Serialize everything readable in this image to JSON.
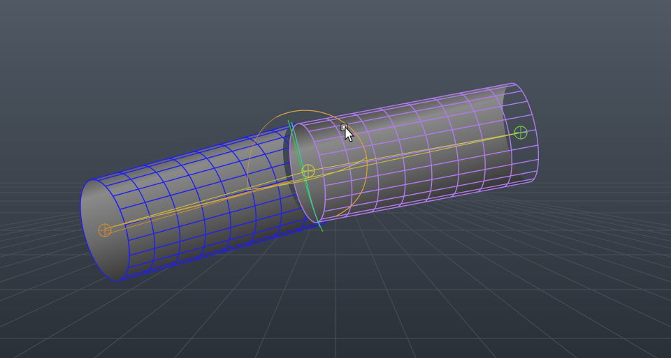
{
  "viewport": {
    "background_top": "#505964",
    "background_bottom": "#2a3038",
    "grid_color": "#48505a"
  },
  "objects": [
    {
      "name": "cylinder-blue",
      "wire_color": "#1f1ff2",
      "state": "selected"
    },
    {
      "name": "cylinder-purple",
      "wire_color": "#b07bf0",
      "state": "highlighted"
    }
  ],
  "joint": {
    "rotate_manipulator_color": "#e0a040",
    "axis_color": "#2ecc40",
    "bone_color": "#c8c840"
  },
  "cursor": {
    "icon": "arrow-cursor-icon"
  }
}
